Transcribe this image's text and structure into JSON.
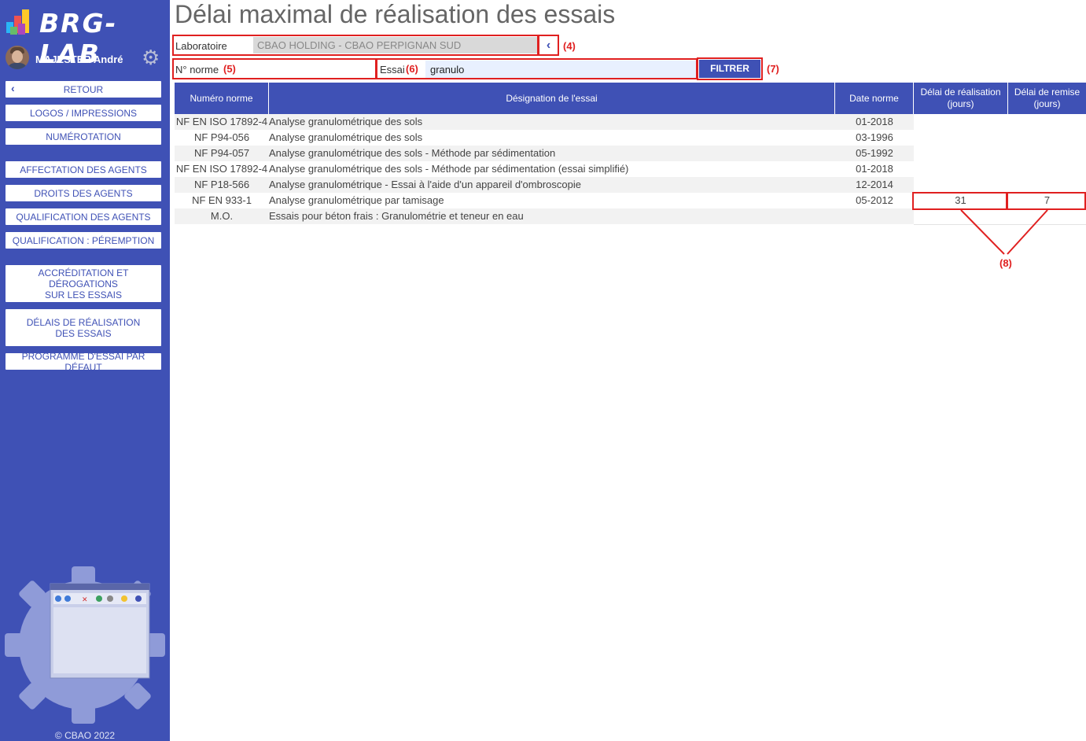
{
  "app": {
    "logo_text": "BRG-LAB",
    "user_name": "MAJESTER André",
    "copyright": "© CBAO 2022"
  },
  "nav": {
    "retour": "RETOUR",
    "logos": "LOGOS / IMPRESSIONS",
    "numerotation": "NUMÉROTATION",
    "affectation": "AFFECTATION DES AGENTS",
    "droits": "DROITS DES AGENTS",
    "qualification": "QUALIFICATION DES AGENTS",
    "qualification_peremption": "QUALIFICATION : PÉREMPTION",
    "accreditation_line1": "ACCRÉDITATION ET DÉROGATIONS",
    "accreditation_line2": "SUR LES ESSAIS",
    "delais_line1": "DÉLAIS DE RÉALISATION",
    "delais_line2": "DES ESSAIS",
    "programme": "PROGRAMME D'ESSAI PAR DÉFAUT"
  },
  "page": {
    "title": "Délai maximal de réalisation des essais"
  },
  "filters": {
    "laboratoire_label": "Laboratoire",
    "laboratoire_value": "CBAO HOLDING - CBAO PERPIGNAN SUD",
    "norme_label": "N° norme",
    "norme_value": "",
    "essai_label": "Essai",
    "essai_value": "granulo",
    "filtrer_label": "FILTRER"
  },
  "annotations": {
    "a4": "(4)",
    "a5": "(5)",
    "a6": "(6)",
    "a7": "(7)",
    "a8": "(8)"
  },
  "table": {
    "headers": {
      "numero": "Numéro norme",
      "designation": "Désignation de l'essai",
      "date": "Date norme",
      "delai_line1": "Délai de réalisation",
      "delai_line2": "(jours)",
      "remise_line1": "Délai de remise",
      "remise_line2": "(jours)"
    },
    "rows": [
      {
        "numero": "NF EN ISO 17892-4",
        "designation": "Analyse granulométrique des sols",
        "date": "01-2018"
      },
      {
        "numero": "NF P94-056",
        "designation": "Analyse granulométrique des sols",
        "date": "03-1996"
      },
      {
        "numero": "NF P94-057",
        "designation": "Analyse granulométrique des sols - Méthode par sédimentation",
        "date": "05-1992"
      },
      {
        "numero": "NF EN ISO 17892-4",
        "designation": "Analyse granulométrique des sols - Méthode par sédimentation (essai simplifié)",
        "date": "01-2018"
      },
      {
        "numero": "NF P18-566",
        "designation": "Analyse granulométrique - Essai à l'aide d'un appareil d'ombroscopie",
        "date": "12-2014"
      },
      {
        "numero": "NF EN 933-1",
        "designation": "Analyse granulométrique par tamisage",
        "date": "05-2012"
      },
      {
        "numero": "M.O.",
        "designation": "Essais pour béton frais : Granulométrie et teneur en eau",
        "date": ""
      }
    ],
    "delai_value": "31",
    "remise_value": "7"
  }
}
